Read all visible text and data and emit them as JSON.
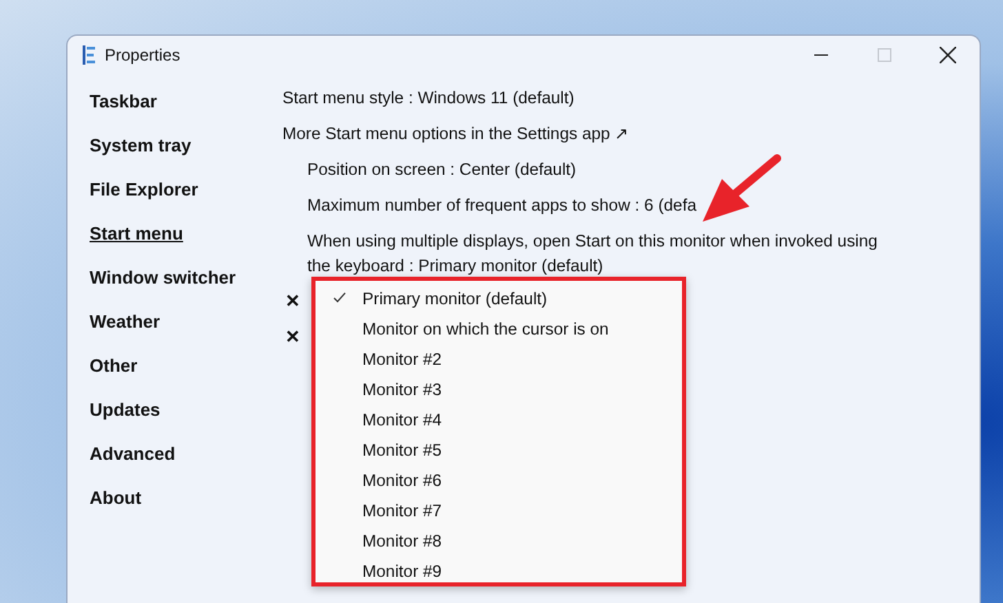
{
  "window": {
    "title": "Properties",
    "maximize_disabled": true
  },
  "sidebar": {
    "items": [
      {
        "label": "Taskbar",
        "selected": false
      },
      {
        "label": "System tray",
        "selected": false
      },
      {
        "label": "File Explorer",
        "selected": false
      },
      {
        "label": "Start menu",
        "selected": true
      },
      {
        "label": "Window switcher",
        "selected": false
      },
      {
        "label": "Weather",
        "selected": false
      },
      {
        "label": "Other",
        "selected": false
      },
      {
        "label": "Updates",
        "selected": false
      },
      {
        "label": "Advanced",
        "selected": false
      },
      {
        "label": "About",
        "selected": false
      }
    ]
  },
  "settings": [
    {
      "kind": "option",
      "text": "Start menu style : Windows 11 (default)",
      "indented": false
    },
    {
      "kind": "link",
      "text": "More Start menu options in the Settings app ↗",
      "indented": false
    },
    {
      "kind": "option",
      "text": "Position on screen : Center (default)",
      "indented": true
    },
    {
      "kind": "option",
      "text": "Maximum number of frequent apps to show : 6 (defa",
      "indented": true
    },
    {
      "kind": "option",
      "text": "When using multiple displays, open Start on this monitor when invoked using the keyboard : Primary monitor (default)",
      "indented": true
    },
    {
      "kind": "toggle",
      "text": "✕"
    },
    {
      "kind": "toggle",
      "text": "✕"
    }
  ],
  "dropdown": {
    "items": [
      {
        "label": "Primary monitor (default)",
        "selected": true
      },
      {
        "label": "Monitor on which the cursor is on",
        "selected": false
      },
      {
        "label": "Monitor #2",
        "selected": false
      },
      {
        "label": "Monitor #3",
        "selected": false
      },
      {
        "label": "Monitor #4",
        "selected": false
      },
      {
        "label": "Monitor #5",
        "selected": false
      },
      {
        "label": "Monitor #6",
        "selected": false
      },
      {
        "label": "Monitor #7",
        "selected": false
      },
      {
        "label": "Monitor #8",
        "selected": false
      },
      {
        "label": "Monitor #9",
        "selected": false
      }
    ]
  }
}
